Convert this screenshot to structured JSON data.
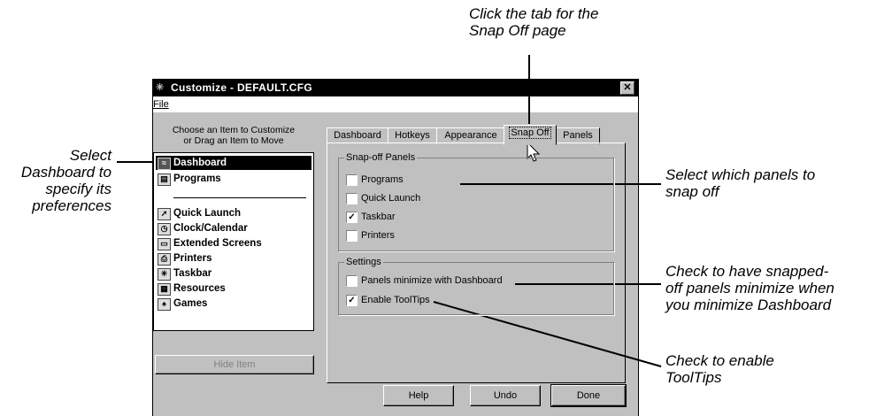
{
  "callouts": {
    "top": [
      "Click the tab for the",
      "Snap Off page"
    ],
    "left": [
      "Select",
      "Dashboard to",
      "specify its",
      "preferences"
    ],
    "right_panels": [
      "Select which panels to",
      "snap off"
    ],
    "right_minimize": [
      "Check to have snapped-",
      "off panels minimize when",
      "you minimize Dashboard"
    ],
    "right_tooltips": [
      "Check to enable",
      "ToolTips"
    ]
  },
  "window": {
    "title": "Customize - DEFAULT.CFG",
    "menu": {
      "file": "File"
    },
    "list_header": [
      "Choose an Item to Customize",
      "or Drag an Item to Move"
    ],
    "items_top": [
      {
        "label": "Dashboard",
        "icon": "dashboard-icon",
        "selected": true
      },
      {
        "label": "Programs",
        "icon": "programs-icon",
        "selected": false
      }
    ],
    "items_bottom": [
      {
        "label": "Quick Launch",
        "icon": "quick-launch-icon"
      },
      {
        "label": "Clock/Calendar",
        "icon": "clock-icon"
      },
      {
        "label": "Extended Screens",
        "icon": "extended-screens-icon"
      },
      {
        "label": "Printers",
        "icon": "printer-icon"
      },
      {
        "label": "Taskbar",
        "icon": "taskbar-icon"
      },
      {
        "label": "Resources",
        "icon": "resources-icon"
      },
      {
        "label": "Games",
        "icon": "games-icon"
      }
    ],
    "hide_button": "Hide Item",
    "tabs": [
      "Dashboard",
      "Hotkeys",
      "Appearance",
      "Snap Off",
      "Panels"
    ],
    "active_tab": "Snap Off",
    "snap_group": {
      "title": "Snap-off Panels",
      "options": [
        {
          "label": "Programs",
          "checked": false
        },
        {
          "label": "Quick Launch",
          "checked": false
        },
        {
          "label": "Taskbar",
          "checked": true
        },
        {
          "label": "Printers",
          "checked": false
        }
      ]
    },
    "settings_group": {
      "title": "Settings",
      "options": [
        {
          "label": "Panels minimize with Dashboard",
          "checked": false
        },
        {
          "label": "Enable ToolTips",
          "checked": true
        }
      ]
    },
    "buttons": {
      "help": "Help",
      "undo": "Undo",
      "done": "Done"
    }
  }
}
